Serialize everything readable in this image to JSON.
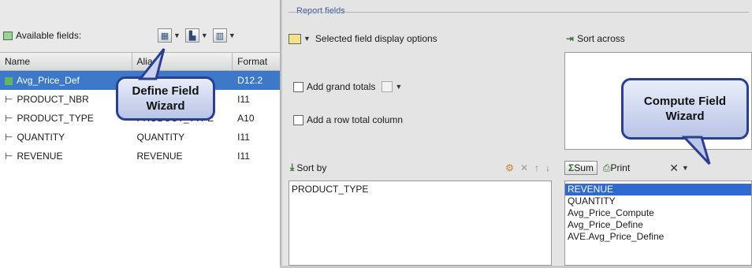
{
  "left_panel": {
    "toolbar_label": "Available fields:",
    "columns": [
      "Name",
      "Alias /",
      "Format"
    ],
    "rows": [
      {
        "name": "Avg_Price_Def",
        "alias": "",
        "format": "D12.2"
      },
      {
        "name": "PRODUCT_NBR",
        "alias": "",
        "format": "I11"
      },
      {
        "name": "PRODUCT_TYPE",
        "alias": "PRODUCT_TYPE",
        "format": "A10"
      },
      {
        "name": "QUANTITY",
        "alias": "QUANTITY",
        "format": "I11"
      },
      {
        "name": "REVENUE",
        "alias": "REVENUE",
        "format": "I11"
      }
    ]
  },
  "right_panel": {
    "group_label": "Report fields",
    "display_options_label": "Selected field display options",
    "sort_across_label": "Sort across",
    "add_grand_totals_label": "Add grand totals",
    "add_row_total_label": "Add a row total column",
    "sort_by_label": "Sort by",
    "sort_by_items": [
      "PRODUCT_TYPE"
    ],
    "sum_label": "Sum",
    "print_label": "Print",
    "measure_items": [
      "REVENUE",
      "QUANTITY",
      "Avg_Price_Compute",
      "Avg_Price_Define",
      "AVE.Avg_Price_Define"
    ]
  },
  "callouts": {
    "define_field": "Define Field Wizard",
    "compute_field": "Compute Field Wizard"
  },
  "colors": {
    "selection": "#3d79c8",
    "callout_border": "#2b3f91"
  }
}
